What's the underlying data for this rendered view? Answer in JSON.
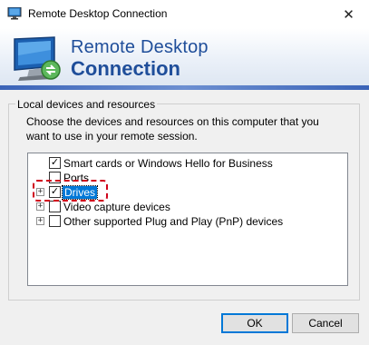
{
  "window": {
    "title": "Remote Desktop Connection",
    "close_glyph": "✕"
  },
  "banner": {
    "line1": "Remote Desktop",
    "line2": "Connection"
  },
  "group": {
    "legend": "Local devices and resources",
    "description": "Choose the devices and resources on this computer that you want to use in your remote session."
  },
  "tree": {
    "items": [
      {
        "label": "Smart cards or Windows Hello for Business",
        "checked": true,
        "expander": "",
        "selected": false
      },
      {
        "label": "Ports",
        "checked": false,
        "expander": "",
        "selected": false
      },
      {
        "label": "Drives",
        "checked": true,
        "expander": "+",
        "selected": true
      },
      {
        "label": "Video capture devices",
        "checked": false,
        "expander": "+",
        "selected": false
      },
      {
        "label": "Other supported Plug and Play (PnP) devices",
        "checked": false,
        "expander": "+",
        "selected": false
      }
    ]
  },
  "buttons": {
    "ok": "OK",
    "cancel": "Cancel"
  },
  "colors": {
    "accent": "#0078d7",
    "title_blue": "#1f4e9a",
    "annotation_red": "#d0021b"
  }
}
